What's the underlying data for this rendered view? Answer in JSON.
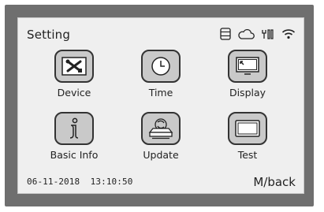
{
  "header": {
    "title": "Setting",
    "status_icons": [
      "storage-icon",
      "cloud-icon",
      "signal-bars-icon",
      "wifi-icon"
    ]
  },
  "menu": {
    "items": [
      {
        "label": "Device",
        "icon": "tools-icon"
      },
      {
        "label": "Time",
        "icon": "clock-icon"
      },
      {
        "label": "Display",
        "icon": "monitor-icon"
      },
      {
        "label": "Basic Info",
        "icon": "info-icon"
      },
      {
        "label": "Update",
        "icon": "update-icon"
      },
      {
        "label": "Test",
        "icon": "test-screen-icon"
      }
    ]
  },
  "footer": {
    "datetime": "06-11-2018  13:10:50",
    "back_label": "M/back"
  }
}
